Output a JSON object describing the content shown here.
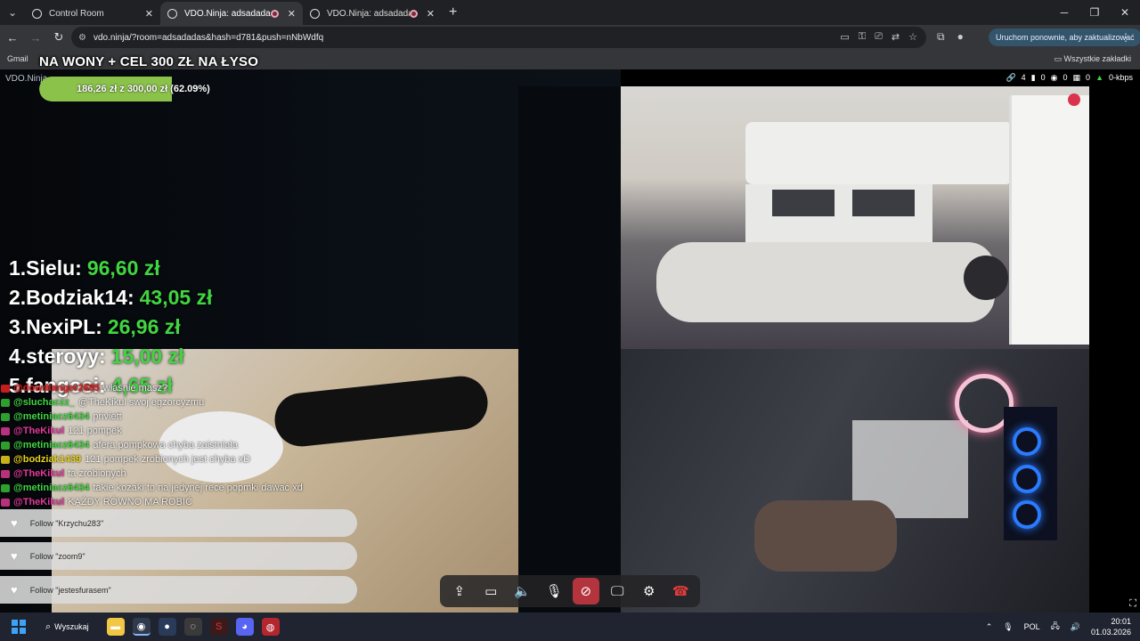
{
  "browser": {
    "tabs": [
      {
        "title": "Control Room",
        "active": false
      },
      {
        "title": "VDO.Ninja: adsadadas",
        "active": true
      },
      {
        "title": "VDO.Ninja: adsadadas",
        "active": false
      }
    ],
    "url": "vdo.ninja/?room=adsadadas&hash=d781&push=nNbWdfq",
    "update_label": "Uruchom ponownie, aby zaktualizować",
    "bookmarks_left": "Gmail",
    "bookmarks_right": "Wszystkie zakładki"
  },
  "page": {
    "vdo_label": "VDO.Ninja",
    "stats": {
      "links": "4",
      "battery": "0",
      "views": "0",
      "cpu": "0",
      "bitrate": "0-kbps"
    }
  },
  "goal": {
    "title": "NA WONY + CEL 300 ZŁ NA ŁYSO",
    "text": "186,26 zł z 300,00 zł (62.09%)",
    "progress": 0.6209,
    "color": "#8bc34a"
  },
  "leaderboard": [
    {
      "name": "1.Sielu:",
      "amount": "96,60 zł"
    },
    {
      "name": "2.Bodziak14:",
      "amount": "43,05 zł"
    },
    {
      "name": "3.NexiPL:",
      "amount": "26,96 zł"
    },
    {
      "name": "4.steroyy:",
      "amount": "15,00 zł"
    },
    {
      "name": "5.fangosi:",
      "amount": "4,65 zł"
    }
  ],
  "chat": [
    {
      "user": "@dowdlanger2585",
      "text": "właśnie masz?",
      "color": "#e11d1d",
      "badge": "#c81d1d"
    },
    {
      "user": "@sluchaczz_",
      "text": "@TheKikul swoj egzorcyzmu",
      "color": "#41d641",
      "badge": "#2e9e2e"
    },
    {
      "user": "@metiniacz6434",
      "text": "priviett",
      "color": "#41d641",
      "badge": "#2e9e2e"
    },
    {
      "user": "@TheKikul",
      "text": "121 pompek",
      "color": "#e0399a",
      "badge": "#b8317c"
    },
    {
      "user": "@metiniacz6434",
      "text": "afera pompkowa chyba zaistniała",
      "color": "#41d641",
      "badge": "#2e9e2e"
    },
    {
      "user": "@bodziak1439",
      "text": "121 pompek zrobionych jest chyba xD",
      "color": "#e8d21a",
      "badge": "#c8b01a"
    },
    {
      "user": "@TheKikul",
      "text": "ta zrobionych",
      "color": "#e0399a",
      "badge": "#b8317c"
    },
    {
      "user": "@metiniacz6434",
      "text": "takie kozaki to na jedynej rece popmki dawać xd",
      "color": "#41d641",
      "badge": "#2e9e2e"
    },
    {
      "user": "@TheKikul",
      "text": "KAŻDY RÓWNO MA ROBIĆ",
      "color": "#e0399a",
      "badge": "#b8317c"
    }
  ],
  "follows": [
    {
      "text": "Follow \"Krzychu283\""
    },
    {
      "text": "Follow \"zoom9\""
    },
    {
      "text": "Follow \"jestesfurasem\""
    }
  ],
  "taskbar": {
    "search_label": "Wyszukaj",
    "lang": "POL",
    "time": "20:01",
    "date": "01.03.2026"
  }
}
